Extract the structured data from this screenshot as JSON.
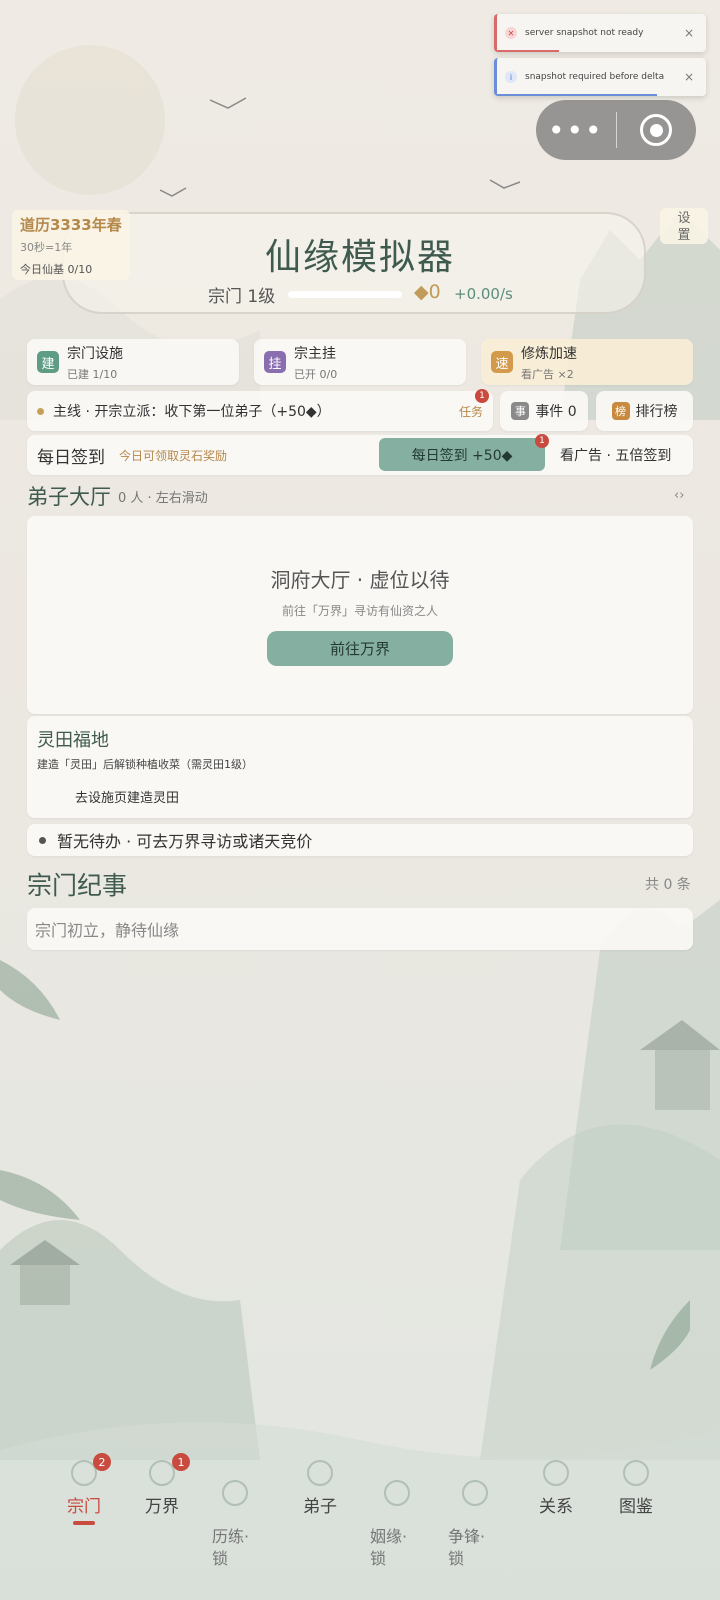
{
  "toasts": [
    {
      "type": "error",
      "text": "server snapshot not ready",
      "close": "×",
      "icon": "error-icon"
    },
    {
      "type": "info",
      "text": "snapshot required before delta",
      "close": "×",
      "icon": "info-icon"
    }
  ],
  "capsule": {
    "menu": "•••",
    "icon_close": "record-icon"
  },
  "calendar": {
    "year": "道历3333年春",
    "rate": "30秒=1年",
    "daily": "今日仙基 0/10"
  },
  "settings": {
    "label": "设\n置"
  },
  "header": {
    "title": "仙缘模拟器",
    "level": "宗门 1级",
    "stones": "◆0",
    "income": "+0.00/s",
    "level_progress": 0
  },
  "facilities": [
    {
      "badge": "建",
      "badge_color": "#5f9c85",
      "title": "宗门设施",
      "sub": "已建 1/10"
    },
    {
      "badge": "挂",
      "badge_color": "#8a6fb0",
      "title": "宗主挂",
      "sub": "已开 0/0"
    },
    {
      "badge": "速",
      "badge_color": "#d49a4c",
      "title": "修炼加速",
      "sub": "看广告 ×2"
    }
  ],
  "mainline": {
    "text": "主线 · 开宗立派：收下第一位弟子（+50◆）",
    "task": "任务",
    "task_badge": "1"
  },
  "events": {
    "badge": "事",
    "label": "事件 0"
  },
  "ranking": {
    "badge": "榜",
    "label": "排行榜"
  },
  "signin": {
    "title": "每日签到",
    "hint": "今日可领取灵石奖励",
    "button": "每日签到 +50◆",
    "button_badge": "1",
    "ad": "看广告 · 五倍签到"
  },
  "hall": {
    "title": "弟子大厅",
    "sub": "0 人 · 左右滑动",
    "arrows": "‹›",
    "empty_title": "洞府大厅 · 虚位以待",
    "empty_sub": "前往「万界」寻访有仙资之人",
    "button": "前往万界"
  },
  "field": {
    "title": "灵田福地",
    "desc": "建造「灵田」后解锁种植收菜（需灵田1级）",
    "button": "去设施页建造灵田"
  },
  "todo": {
    "text": "暂无待办 · 可去万界寻访或诸天竞价"
  },
  "chronicle": {
    "title": "宗门纪事",
    "count": "共 0 条",
    "entry": "宗门初立，静待仙缘"
  },
  "nav": [
    {
      "label": "宗门",
      "badge": "2",
      "active": true,
      "icon": "sect-icon"
    },
    {
      "label": "万界",
      "badge": "1",
      "active": false,
      "icon": "realm-icon"
    },
    {
      "label": "历练·\n锁",
      "badge": "",
      "active": false,
      "icon": "training-icon"
    },
    {
      "label": "弟子",
      "badge": "",
      "active": false,
      "icon": "disciple-icon"
    },
    {
      "label": "姻缘·\n锁",
      "badge": "",
      "active": false,
      "icon": "marriage-icon"
    },
    {
      "label": "争锋·\n锁",
      "badge": "",
      "active": false,
      "icon": "contest-icon"
    },
    {
      "label": "关系",
      "badge": "",
      "active": false,
      "icon": "relation-icon"
    },
    {
      "label": "图鉴",
      "badge": "",
      "active": false,
      "icon": "codex-icon"
    }
  ]
}
